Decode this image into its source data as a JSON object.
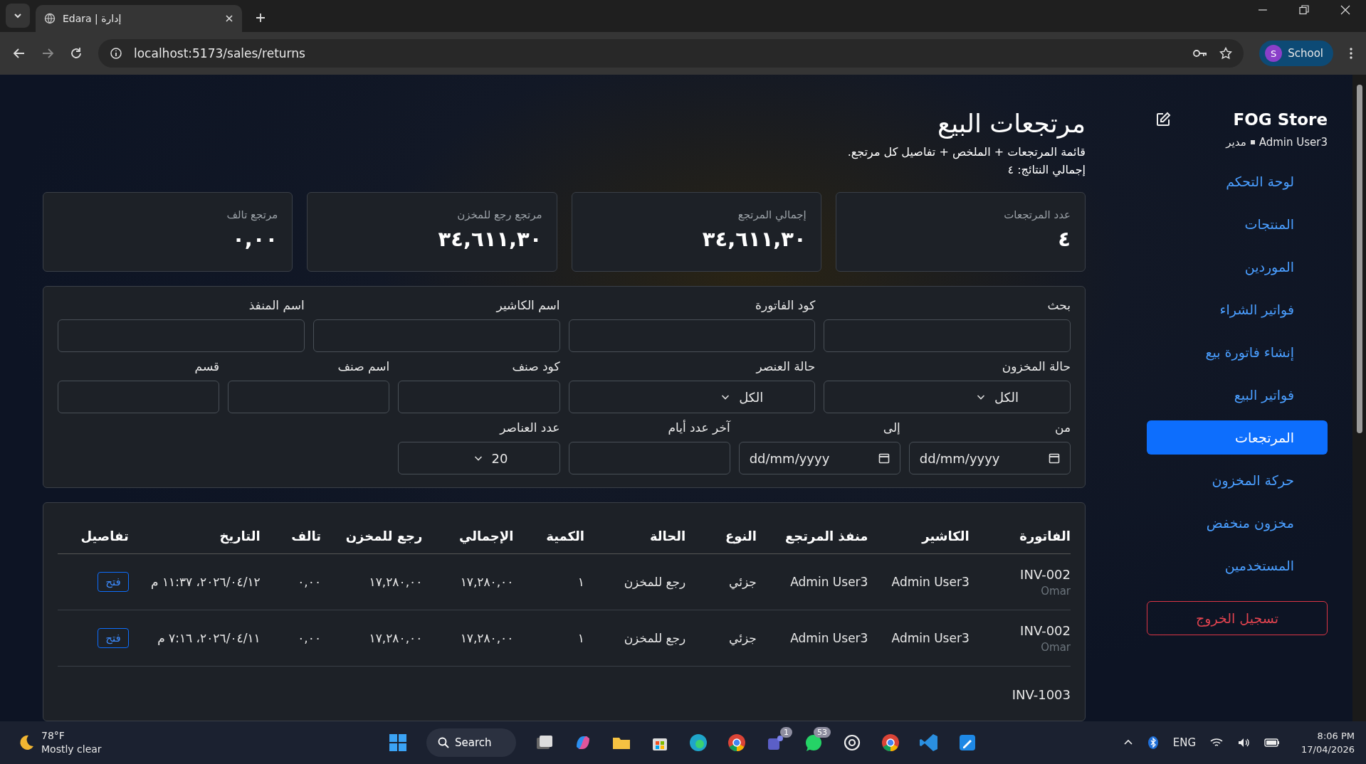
{
  "browser": {
    "tab_title": "Edara | إدارة",
    "url": "localhost:5173/sales/returns",
    "profile_initial": "S",
    "profile_label": "School"
  },
  "sidebar": {
    "store_name": "FOG Store",
    "user": "Admin User3",
    "role": "مدير",
    "items": [
      {
        "label": "لوحة التحكم",
        "selected": false
      },
      {
        "label": "المنتجات",
        "selected": false
      },
      {
        "label": "الموردين",
        "selected": false
      },
      {
        "label": "فواتير الشراء",
        "selected": false
      },
      {
        "label": "إنشاء فاتورة بيع",
        "selected": false
      },
      {
        "label": "فواتير البيع",
        "selected": false
      },
      {
        "label": "المرتجعات",
        "selected": true
      },
      {
        "label": "حركة المخزون",
        "selected": false
      },
      {
        "label": "مخزون منخفض",
        "selected": false
      },
      {
        "label": "المستخدمين",
        "selected": false
      }
    ],
    "logout": "تسجيل الخروج"
  },
  "page": {
    "title": "مرتجعات البيع",
    "subtitle": "قائمة المرتجعات + الملخص + تفاصيل كل مرتجع.",
    "total": "إجمالي النتائج: ٤"
  },
  "stats": [
    {
      "label": "عدد المرتجعات",
      "value": "٤"
    },
    {
      "label": "إجمالي المرتجع",
      "value": "٣٤,٦١١,٣٠"
    },
    {
      "label": "مرتجع رجع للمخزن",
      "value": "٣٤,٦١١,٣٠"
    },
    {
      "label": "مرتجع تالف",
      "value": "٠,٠٠"
    }
  ],
  "filters": [
    [
      {
        "label": "بحث",
        "kind": "text"
      },
      {
        "label": "كود الفاتورة",
        "kind": "text"
      },
      {
        "label": "اسم الكاشير",
        "kind": "text"
      },
      {
        "label": "اسم المنفذ",
        "kind": "text"
      }
    ],
    [
      {
        "label": "حالة المخزون",
        "kind": "select",
        "value": "الكل"
      },
      {
        "label": "حالة العنصر",
        "kind": "select",
        "value": "الكل"
      },
      {
        "label": "كود صنف",
        "kind": "text"
      },
      {
        "label": "اسم صنف",
        "kind": "text"
      },
      {
        "label": "قسم",
        "kind": "text"
      }
    ],
    [
      {
        "label": "من",
        "kind": "date",
        "value": "dd/mm/yyyy"
      },
      {
        "label": "إلى",
        "kind": "date",
        "value": "dd/mm/yyyy"
      },
      {
        "label": "آخر عدد أيام",
        "kind": "text"
      },
      {
        "label": "عدد العناصر",
        "kind": "select",
        "value": "20"
      }
    ]
  ],
  "table": {
    "columns": [
      "الفاتورة",
      "الكاشير",
      "منفذ المرتجع",
      "النوع",
      "الحالة",
      "الكمية",
      "الإجمالي",
      "رجع للمخزن",
      "تالف",
      "التاريخ",
      "تفاصيل"
    ],
    "rows": [
      {
        "invoice": "INV-002",
        "customer": "Omar",
        "cashier": "Admin User3",
        "outlet": "Admin User3",
        "type": "جزئي",
        "status": "رجع للمخزن",
        "qty": "١",
        "total": "١٧,٢٨٠,٠٠",
        "restock": "١٧,٢٨٠,٠٠",
        "damaged": "٠,٠٠",
        "date": "١٢‏/٠٤‏/٢٠٢٦، ١١:٣٧ م",
        "action": "فتح"
      },
      {
        "invoice": "INV-002",
        "customer": "Omar",
        "cashier": "Admin User3",
        "outlet": "Admin User3",
        "type": "جزئي",
        "status": "رجع للمخزن",
        "qty": "١",
        "total": "١٧,٢٨٠,٠٠",
        "restock": "١٧,٢٨٠,٠٠",
        "damaged": "٠,٠٠",
        "date": "١١‏/٠٤‏/٢٠٢٦، ٧:١٦ م",
        "action": "فتح"
      },
      {
        "invoice": "INV-1003"
      }
    ]
  },
  "taskbar": {
    "temperature": "78°F",
    "weather": "Mostly clear",
    "search": "Search",
    "teams_badge": "1",
    "whatsapp_badge": "53",
    "language": "ENG",
    "time": "8:06 PM",
    "date": "17/04/2026"
  }
}
